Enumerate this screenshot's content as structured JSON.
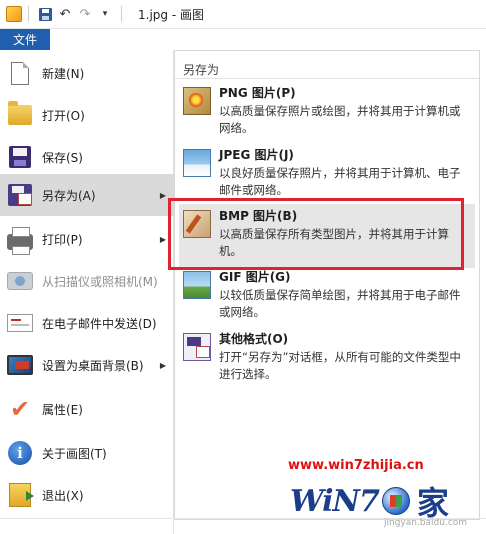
{
  "titlebar": {
    "title": "1.jpg - 画图"
  },
  "tabs": {
    "file_label": "文件"
  },
  "menu": {
    "items": [
      {
        "label": "新建(N)",
        "icon": "new-document-icon"
      },
      {
        "label": "打开(O)",
        "icon": "open-folder-icon"
      },
      {
        "label": "保存(S)",
        "icon": "save-icon"
      },
      {
        "label": "另存为(A)",
        "icon": "save-as-icon"
      },
      {
        "label": "打印(P)",
        "icon": "printer-icon"
      },
      {
        "label": "从扫描仪或照相机(M)",
        "icon": "scanner-icon"
      },
      {
        "label": "在电子邮件中发送(D)",
        "icon": "email-icon"
      },
      {
        "label": "设置为桌面背景(B)",
        "icon": "desktop-background-icon"
      },
      {
        "label": "属性(E)",
        "icon": "properties-check-icon"
      },
      {
        "label": "关于画图(T)",
        "icon": "info-icon"
      },
      {
        "label": "退出(X)",
        "icon": "exit-icon"
      }
    ]
  },
  "submenu": {
    "header": "另存为",
    "items": [
      {
        "title": "PNG 图片(P)",
        "desc": "以高质量保存照片或绘图，并将其用于计算机或网络。",
        "icon": "png-picture-icon"
      },
      {
        "title": "JPEG 图片(J)",
        "desc": "以良好质量保存照片，并将其用于计算机、电子邮件或网络。",
        "icon": "jpeg-picture-icon"
      },
      {
        "title": "BMP 图片(B)",
        "desc": "以高质量保存所有类型图片，并将其用于计算机。",
        "icon": "bmp-picture-icon"
      },
      {
        "title": "GIF 图片(G)",
        "desc": "以较低质量保存简单绘图，并将其用于电子邮件或网络。",
        "icon": "gif-picture-icon"
      },
      {
        "title": "其他格式(O)",
        "desc": "打开“另存为”对话框，从所有可能的文件类型中进行选择。",
        "icon": "other-formats-icon"
      }
    ]
  },
  "watermark": {
    "url": "www.win7zhijia.cn",
    "logo_text": "WiN7",
    "logo_jia": "家",
    "small_text": "jingyan.baidu.com"
  },
  "colors": {
    "file_tab": "#1f5fae",
    "highlight": "#e0232e",
    "watermark_url": "#e01010",
    "watermark_logo": "#1a3e8a"
  }
}
